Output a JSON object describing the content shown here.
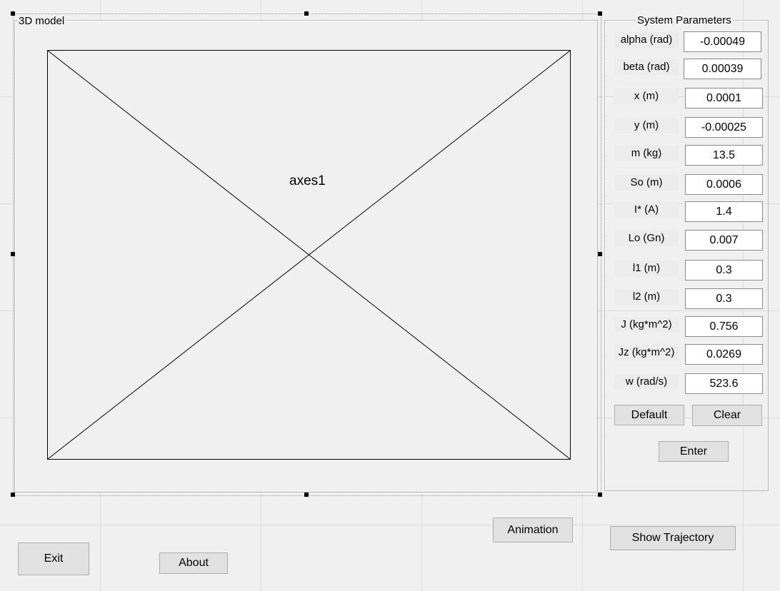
{
  "axes_panel": {
    "title": "3D model",
    "axes_label": "axes1"
  },
  "params_panel": {
    "title": "System Parameters",
    "rows": [
      {
        "label": "alpha (rad)",
        "value": "-0.00049"
      },
      {
        "label": "beta (rad)",
        "value": "0.00039"
      },
      {
        "label": "x (m)",
        "value": "0.0001"
      },
      {
        "label": "y (m)",
        "value": "-0.00025"
      },
      {
        "label": "m (kg)",
        "value": "13.5"
      },
      {
        "label": "So (m)",
        "value": "0.0006"
      },
      {
        "label": "I* (A)",
        "value": "1.4"
      },
      {
        "label": "Lo (Gn)",
        "value": "0.007"
      },
      {
        "label": "l1 (m)",
        "value": "0.3"
      },
      {
        "label": "l2 (m)",
        "value": "0.3"
      },
      {
        "label": "J (kg*m^2)",
        "value": "0.756"
      },
      {
        "label": "Jz (kg*m^2)",
        "value": "0.0269"
      },
      {
        "label": "w (rad/s)",
        "value": "523.6"
      }
    ],
    "default_label": "Default",
    "clear_label": "Clear",
    "enter_label": "Enter"
  },
  "buttons": {
    "animation": "Animation",
    "show_trajectory": "Show Trajectory",
    "exit": "Exit",
    "about": "About"
  }
}
